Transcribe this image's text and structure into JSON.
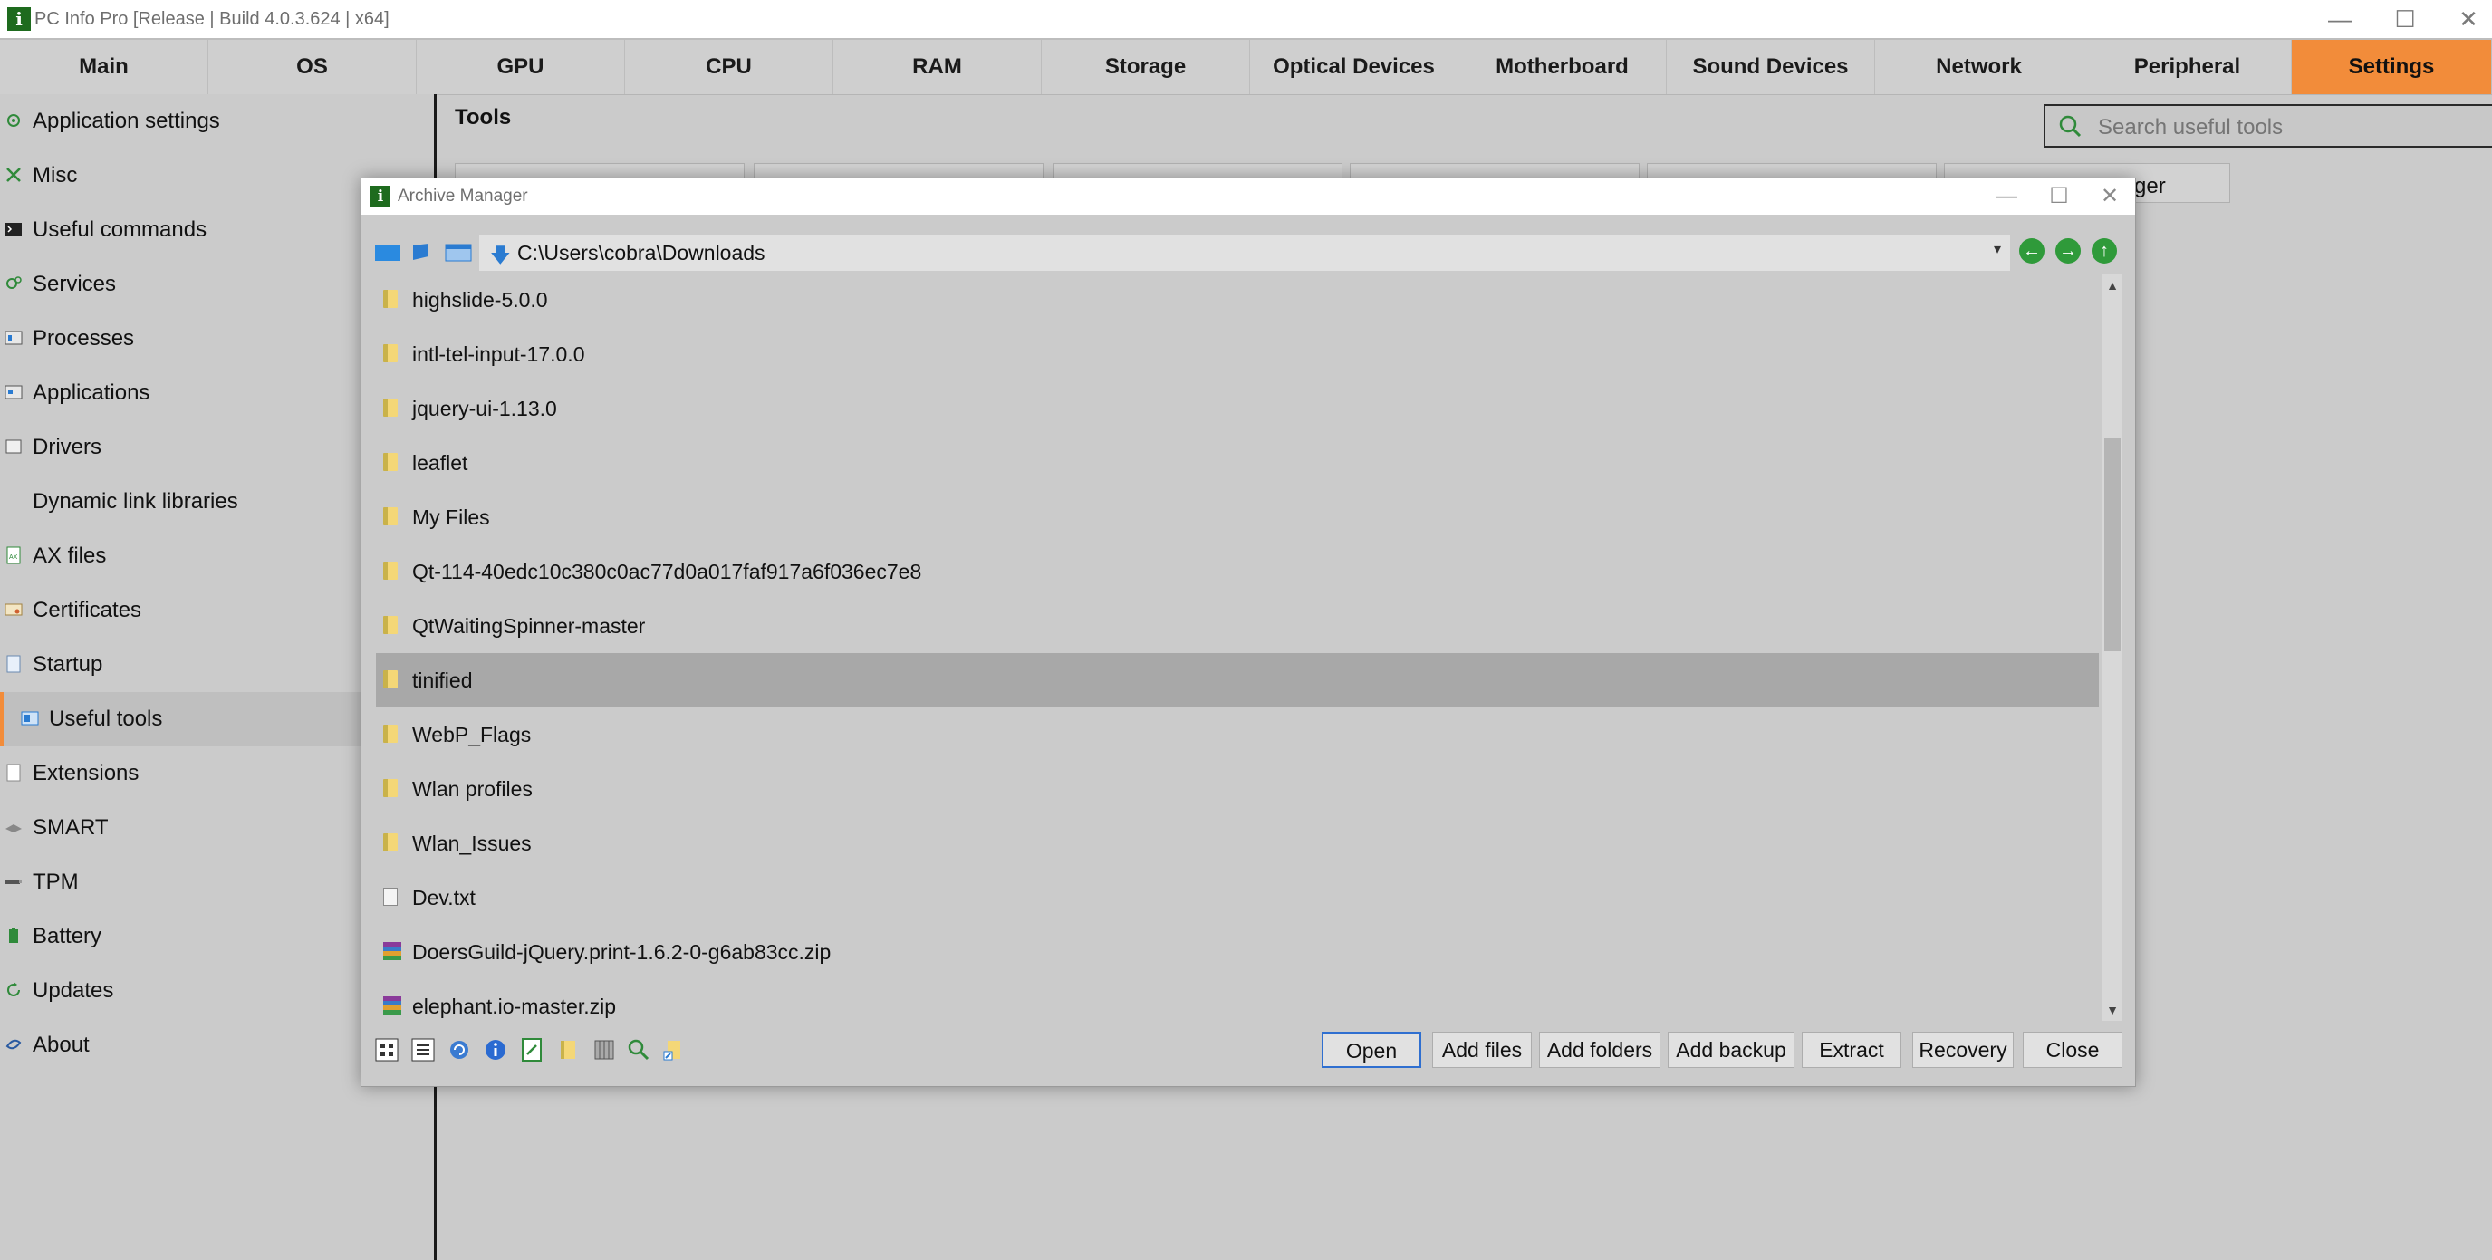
{
  "window": {
    "title": "PC Info Pro [Release | Build 4.0.3.624 | x64]",
    "app_icon_glyph": "i",
    "controls": {
      "minimize": "—",
      "maximize": "☐",
      "close": "✕"
    }
  },
  "topnav": {
    "tabs": [
      {
        "label": "Main"
      },
      {
        "label": "OS"
      },
      {
        "label": "GPU"
      },
      {
        "label": "CPU"
      },
      {
        "label": "RAM"
      },
      {
        "label": "Storage"
      },
      {
        "label": "Optical Devices"
      },
      {
        "label": "Motherboard"
      },
      {
        "label": "Sound Devices"
      },
      {
        "label": "Network"
      },
      {
        "label": "Peripheral"
      },
      {
        "label": "Settings"
      }
    ],
    "active": "Settings",
    "active_color": "#f28c3a"
  },
  "sidebar": {
    "items": [
      {
        "label": "Application settings",
        "icon": "gear-icon"
      },
      {
        "label": "Misc",
        "icon": "tools-icon"
      },
      {
        "label": "Useful commands",
        "icon": "terminal-icon"
      },
      {
        "label": "Services",
        "icon": "services-icon"
      },
      {
        "label": "Processes",
        "icon": "processes-icon"
      },
      {
        "label": "Applications",
        "icon": "applications-icon"
      },
      {
        "label": "Drivers",
        "icon": "drivers-icon"
      },
      {
        "label": "Dynamic link libraries",
        "icon": "dll-icon"
      },
      {
        "label": "AX files",
        "icon": "ax-icon"
      },
      {
        "label": "Certificates",
        "icon": "certificate-icon"
      },
      {
        "label": "Startup",
        "icon": "startup-icon"
      },
      {
        "label": "Useful tools",
        "icon": "useful-tools-icon"
      },
      {
        "label": "Extensions",
        "icon": "extensions-icon"
      },
      {
        "label": "SMART",
        "icon": "smart-icon"
      },
      {
        "label": "TPM",
        "icon": "tpm-icon"
      },
      {
        "label": "Battery",
        "icon": "battery-icon"
      },
      {
        "label": "Updates",
        "icon": "updates-icon"
      },
      {
        "label": "About",
        "icon": "about-icon"
      }
    ],
    "active": "Useful tools"
  },
  "tools": {
    "title": "Tools",
    "search_placeholder": "Search useful tools",
    "partial_button_text": "ger"
  },
  "archive_manager": {
    "title": "Archive Manager",
    "path": "C:\\Users\\cobra\\Downloads",
    "files": [
      {
        "name": "highslide-5.0.0",
        "type": "folder"
      },
      {
        "name": "intl-tel-input-17.0.0",
        "type": "folder"
      },
      {
        "name": "jquery-ui-1.13.0",
        "type": "folder"
      },
      {
        "name": "leaflet",
        "type": "folder"
      },
      {
        "name": "My Files",
        "type": "folder"
      },
      {
        "name": "Qt-114-40edc10c380c0ac77d0a017faf917a6f036ec7e8",
        "type": "folder"
      },
      {
        "name": "QtWaitingSpinner-master",
        "type": "folder"
      },
      {
        "name": "tinified",
        "type": "folder",
        "selected": true
      },
      {
        "name": "WebP_Flags",
        "type": "folder"
      },
      {
        "name": "Wlan profiles",
        "type": "folder"
      },
      {
        "name": "Wlan_Issues",
        "type": "folder"
      },
      {
        "name": "Dev.txt",
        "type": "text"
      },
      {
        "name": "DoersGuild-jQuery.print-1.6.2-0-g6ab83cc.zip",
        "type": "archive"
      },
      {
        "name": "elephant.io-master.zip",
        "type": "archive"
      }
    ],
    "buttons": {
      "open": "Open",
      "add_files": "Add files",
      "add_folders": "Add folders",
      "add_backup": "Add backup",
      "extract": "Extract",
      "recovery": "Recovery",
      "close": "Close"
    },
    "nav": {
      "back": "←",
      "forward": "→",
      "up": "↑"
    }
  }
}
